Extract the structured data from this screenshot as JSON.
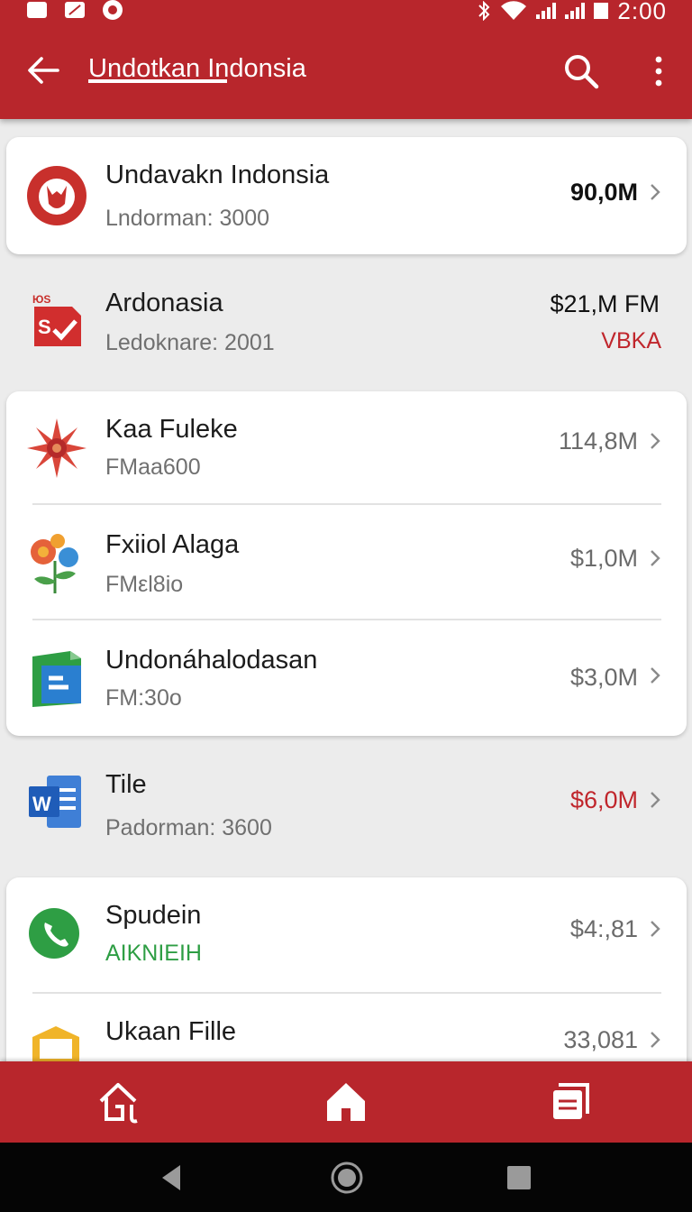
{
  "status_bar": {
    "time": "2:00",
    "icons": [
      "image-icon",
      "no-sim-icon",
      "record-icon",
      "bluetooth-icon",
      "wifi-icon",
      "signal-icon",
      "signal-icon",
      "battery-icon"
    ]
  },
  "app_bar": {
    "title": "Undotkan Indonsia",
    "icons": [
      "back-arrow-icon",
      "search-icon",
      "more-vert-icon"
    ]
  },
  "items": [
    {
      "name": "Undavakn Indonsia",
      "sub": "Lndorman: 3000",
      "value": "90,0M",
      "icon": "fox-logo-icon"
    },
    {
      "name": "Ardonasia",
      "sub": "Ledoknare: 2001",
      "value": "$21,M FM",
      "value2": "VBKA",
      "icon": "sheet-check-icon"
    },
    {
      "name": "Kaa Fuleke",
      "sub": "FMaa600",
      "value": "114,8M",
      "icon": "flower-icon"
    },
    {
      "name": "Fxiiol Alaga",
      "sub": "FMεl8io",
      "value": "$1,0M",
      "icon": "plant-icon"
    },
    {
      "name": "Undonáhalodasan",
      "sub": "FM:30o",
      "value": "$3,0M",
      "icon": "green-doc-icon"
    },
    {
      "name": "Tile",
      "sub": "Padorman: 3600",
      "value": "$6,0M",
      "icon": "word-icon"
    },
    {
      "name": "Spudein",
      "sub": "AIKNIEIH",
      "value": "$4:,81",
      "icon": "phone-icon"
    },
    {
      "name": "Ukaan Fille",
      "sub": "",
      "value": "33,081",
      "icon": "folder-icon"
    }
  ],
  "bottom_nav": [
    "home-outline-icon",
    "home-icon",
    "document-icon"
  ],
  "system_nav": [
    "back-triangle-icon",
    "home-circle-icon",
    "recents-square-icon"
  ],
  "colors": {
    "primary": "#b8262c",
    "accent_red": "#c0262c",
    "green": "#2e9e44"
  }
}
